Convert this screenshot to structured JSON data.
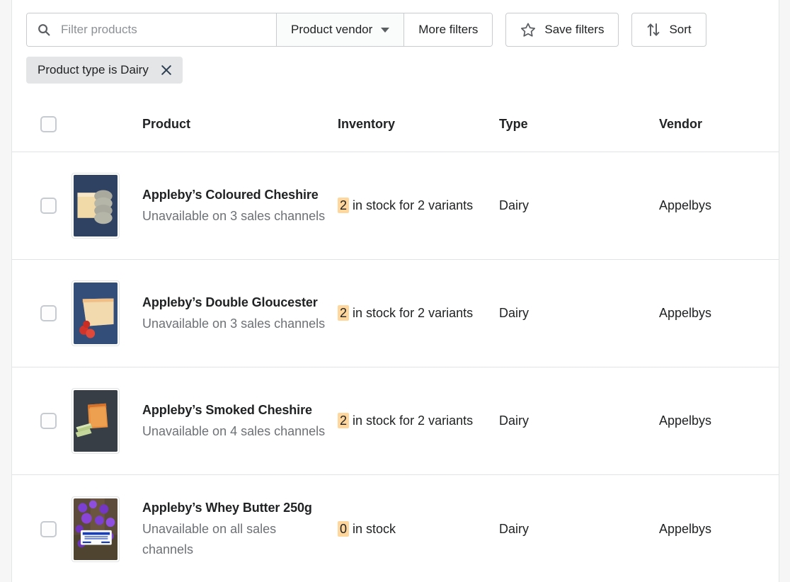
{
  "toolbar": {
    "search": {
      "icon": "search-icon",
      "placeholder": "Filter products",
      "value": ""
    },
    "vendor_filter_label": "Product vendor",
    "more_filters_label": "More filters",
    "save_filters_label": "Save filters",
    "save_filters_icon": "star-icon",
    "sort_label": "Sort",
    "sort_icon": "sort-arrows-icon"
  },
  "applied_filters": [
    {
      "label": "Product type is Dairy",
      "remove_icon": "close-icon"
    }
  ],
  "table": {
    "select_all_checkbox": "unchecked",
    "columns": [
      {
        "key": "product",
        "label": "Product"
      },
      {
        "key": "inventory",
        "label": "Inventory"
      },
      {
        "key": "type",
        "label": "Type"
      },
      {
        "key": "vendor",
        "label": "Vendor"
      }
    ],
    "rows": [
      {
        "checkbox": "unchecked",
        "thumbnail": "coloured-cheshire-thumbnail",
        "title": "Appleby’s Coloured Cheshire",
        "subtitle": "Unavailable on 3 sales channels",
        "inventory_count": "2",
        "inventory_text": "in stock for 2 variants",
        "type": "Dairy",
        "vendor": "Appelbys"
      },
      {
        "checkbox": "unchecked",
        "thumbnail": "double-gloucester-thumbnail",
        "title": "Appleby’s Double Gloucester",
        "subtitle": "Unavailable on 3 sales channels",
        "inventory_count": "2",
        "inventory_text": "in stock for 2 variants",
        "type": "Dairy",
        "vendor": "Appelbys"
      },
      {
        "checkbox": "unchecked",
        "thumbnail": "smoked-cheshire-thumbnail",
        "title": "Appleby’s Smoked Cheshire",
        "subtitle": "Unavailable on 4 sales channels",
        "inventory_count": "2",
        "inventory_text": "in stock for 2 variants",
        "type": "Dairy",
        "vendor": "Appelbys"
      },
      {
        "checkbox": "unchecked",
        "thumbnail": "whey-butter-thumbnail",
        "title": "Appleby’s Whey But­ter 250g",
        "subtitle": "Unavailable on all sales channels",
        "inventory_count": "0",
        "inventory_text": "in stock",
        "type": "Dairy",
        "vendor": "Appelbys"
      }
    ]
  },
  "colors": {
    "inventory_badge": "#ffd79d",
    "chip_background": "#e4e5e7",
    "border": "#e1e3e5",
    "text_primary": "#202223",
    "text_subdued": "#6d7175",
    "page_background": "#f6f6f7"
  }
}
